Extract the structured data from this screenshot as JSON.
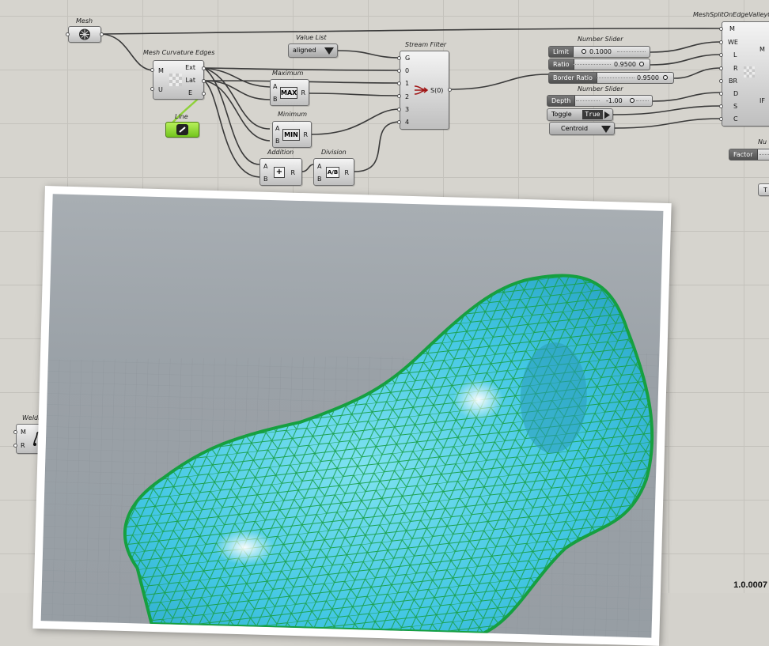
{
  "canvas": {
    "mesh": {
      "caption": "Mesh"
    },
    "mesh_curvature_edges": {
      "caption": "Mesh Curvature Edges",
      "inputs": [
        "M",
        "U"
      ],
      "outputs": [
        "Ext",
        "Lat",
        "E"
      ]
    },
    "line": {
      "caption": "Line"
    },
    "value_list": {
      "caption": "Value List",
      "value": "aligned"
    },
    "maximum": {
      "caption": "Maximum",
      "inputs": [
        "A",
        "B"
      ],
      "icon": "MAX",
      "output": "R"
    },
    "minimum": {
      "caption": "Minimum",
      "inputs": [
        "A",
        "B"
      ],
      "icon": "MIN",
      "output": "R"
    },
    "addition": {
      "caption": "Addition",
      "inputs": [
        "A",
        "B"
      ],
      "icon": "+",
      "output": "R"
    },
    "division": {
      "caption": "Division",
      "inputs": [
        "A",
        "B"
      ],
      "icon": "A/B",
      "output": "R"
    },
    "stream_filter": {
      "caption": "Stream Filter",
      "inputs": [
        "G",
        "0",
        "1",
        "2",
        "3",
        "4"
      ],
      "output": "S(0)"
    },
    "slider_group_1": {
      "caption": "Number Slider",
      "sliders": [
        {
          "label": "Limit",
          "value": "0.1000"
        },
        {
          "label": "Ratio",
          "value": "0.9500"
        },
        {
          "label": "Border Ratio",
          "value": "0.9500"
        }
      ]
    },
    "slider_group_2": {
      "caption": "Number Slider",
      "slider": {
        "label": "Depth",
        "value": "-1.00"
      }
    },
    "toggle": {
      "label": "Toggle",
      "value": "True"
    },
    "centroid": {
      "label": "Centroid"
    },
    "mesh_split": {
      "caption": "MeshSplitOnEdgeValleyC",
      "inputs": [
        "M",
        "WE",
        "L",
        "R",
        "BR",
        "D",
        "S",
        "C"
      ],
      "outputs": [
        "M",
        "IF"
      ]
    },
    "factor": {
      "caption": "Nu",
      "label": "Factor"
    },
    "right_stub": {
      "label": "T"
    },
    "weld": {
      "caption": "WeldMe",
      "inputs": [
        "M",
        "R"
      ]
    }
  },
  "viewport": {
    "version": "1.0.0007",
    "mesh_colors": {
      "fill": "#43c7e4",
      "edges": "#1aa04a",
      "background": "#9ea5ab"
    }
  }
}
